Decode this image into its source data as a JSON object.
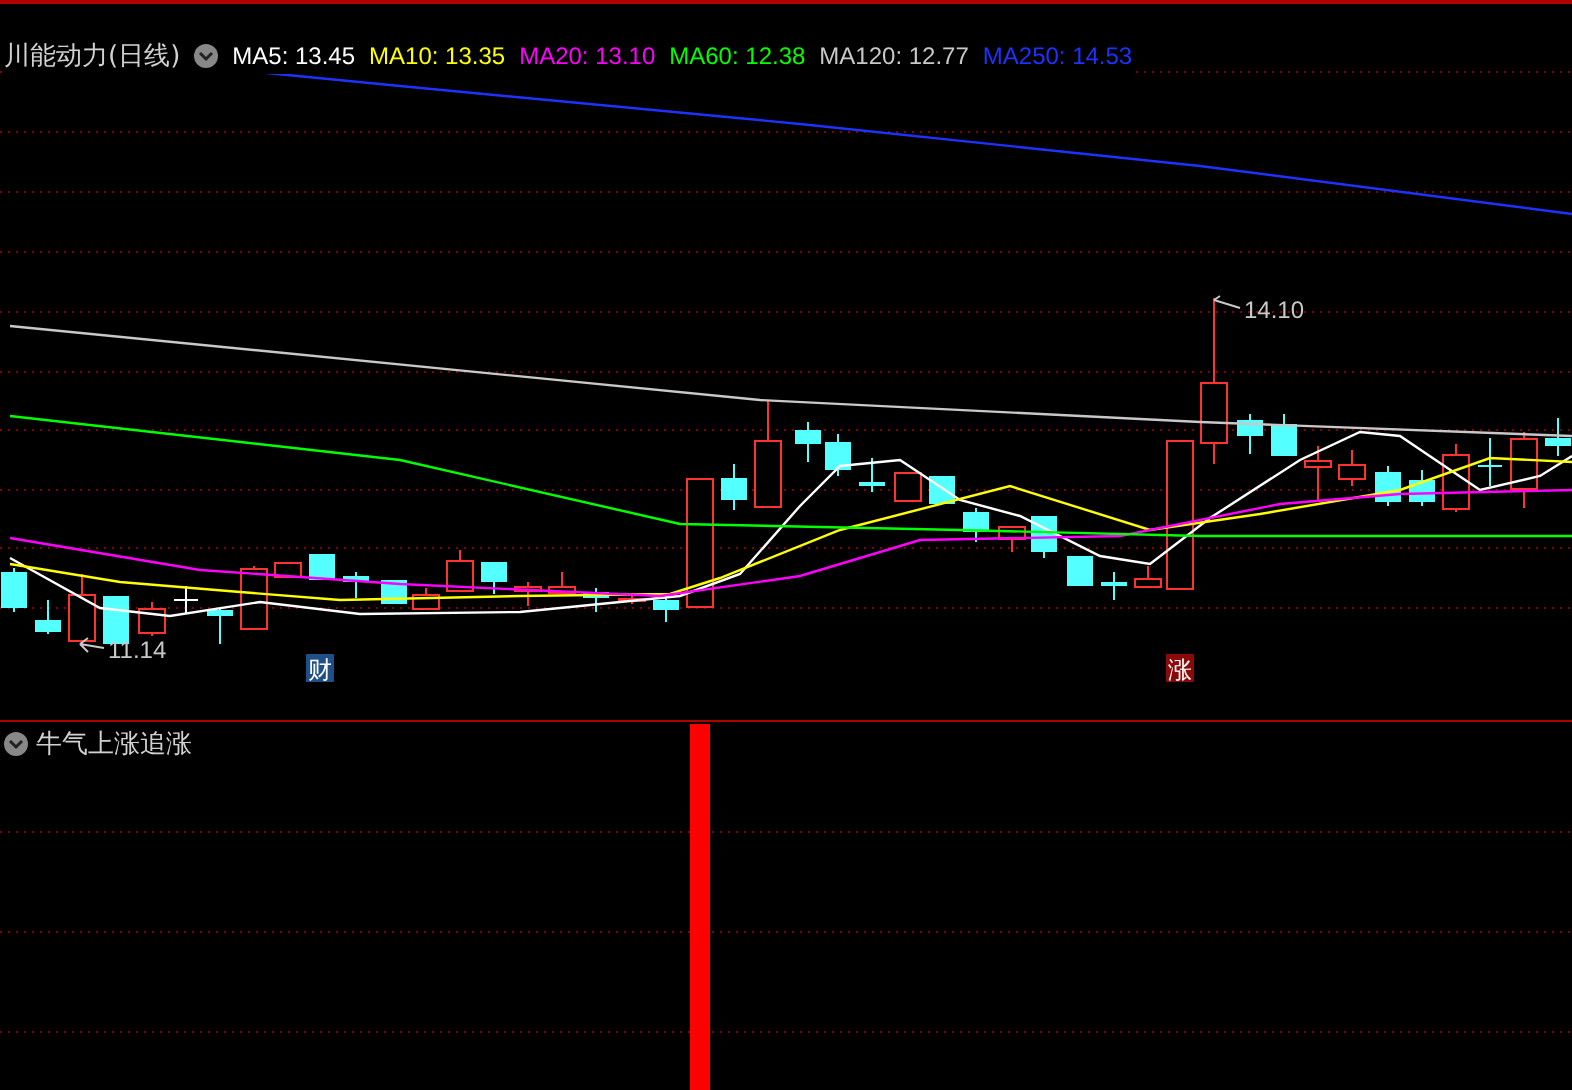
{
  "chart": {
    "title": "川能动力(日线)",
    "legend": [
      {
        "label": "MA5: 13.45",
        "color": "#ffffff"
      },
      {
        "label": "MA10: 13.35",
        "color": "#ffff00"
      },
      {
        "label": "MA20: 13.10",
        "color": "#ff00ff"
      },
      {
        "label": "MA60: 12.38",
        "color": "#00ff00"
      },
      {
        "label": "MA120: 12.77",
        "color": "#c8c8c8"
      },
      {
        "label": "MA250: 14.53",
        "color": "#1e32ff"
      }
    ],
    "high_label": "14.10",
    "low_label": "11.14",
    "markers": [
      {
        "text": "财",
        "color": "#1f4f86"
      },
      {
        "text": "涨",
        "color": "#8a0a0a"
      }
    ]
  },
  "indicator": {
    "title": "牛气上涨追涨"
  }
}
